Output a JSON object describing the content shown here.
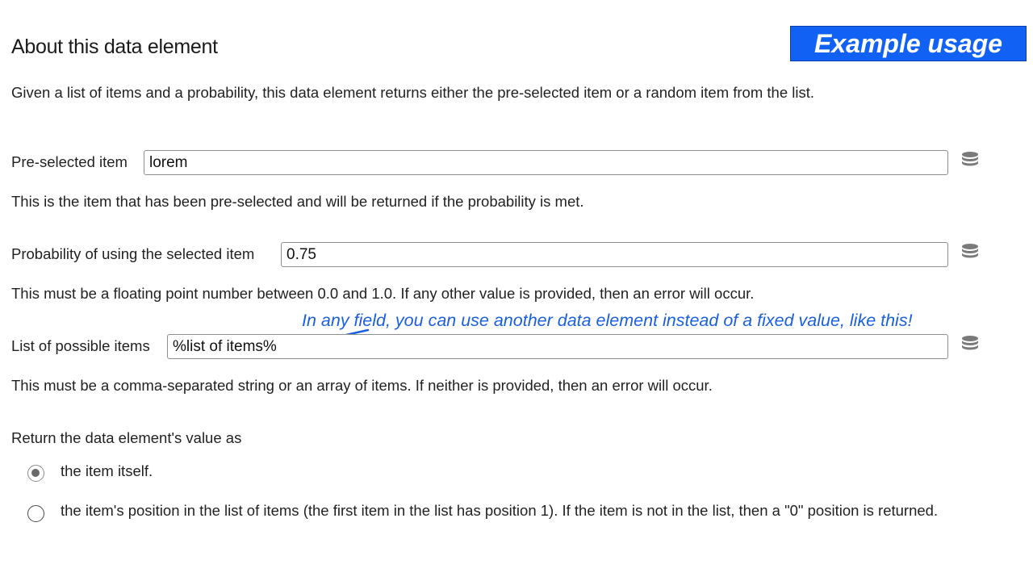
{
  "header": {
    "title": "About this data element",
    "example_badge": "Example usage"
  },
  "intro": "Given a list of items and a probability, this data element returns either the pre-selected item or a random item from the list.",
  "fields": [
    {
      "label": "Pre-selected item",
      "value": "lorem",
      "icon": "database-icon",
      "help": "This is the item that has been pre-selected and will be returned if the probability is met."
    },
    {
      "label": "Probability of using the selected item",
      "value": "0.75",
      "icon": "database-icon",
      "help": "This must be a floating point number between 0.0 and 1.0. If any other value is provided, then an error will occur."
    },
    {
      "label": "List of possible items",
      "value": "%list of items%",
      "icon": "database-icon",
      "help": "This must be a comma-separated string or an array of items. If neither is provided, then an error will occur."
    }
  ],
  "annotation": {
    "text": "In any field, you can use another data element instead of a fixed value, like this!",
    "color": "#1a5fe0"
  },
  "return_as": {
    "label": "Return the data element's value as",
    "options": [
      {
        "label": "the item itself.",
        "selected": true
      },
      {
        "label": "the item's position in the list of items (the first item in the list has position 1). If the item is not in the list, then a \"0\" position is returned.",
        "selected": false
      }
    ]
  },
  "colors": {
    "badge_background": "#1261f5",
    "annotation": "#1a5fe0"
  }
}
